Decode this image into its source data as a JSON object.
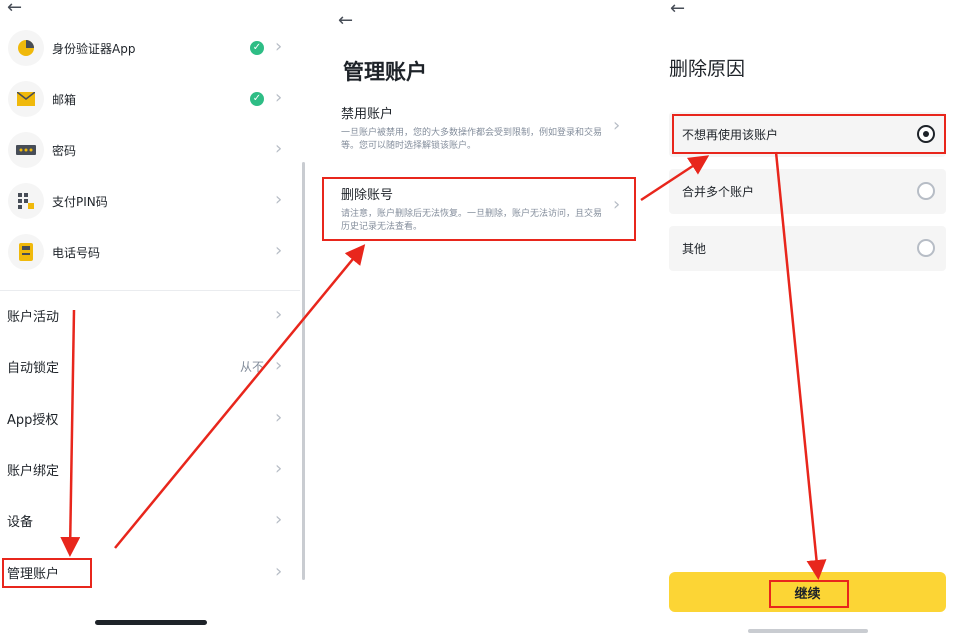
{
  "panel1": {
    "back_icon": "arrow-left-icon",
    "security_items": [
      {
        "label": "身份验证器App",
        "icon": "authenticator-icon",
        "verified": true
      },
      {
        "label": "邮箱",
        "icon": "mail-icon",
        "verified": true
      },
      {
        "label": "密码",
        "icon": "password-icon",
        "verified": false
      },
      {
        "label": "支付PIN码",
        "icon": "pin-icon",
        "verified": false
      },
      {
        "label": "电话号码",
        "icon": "phone-icon",
        "verified": false
      }
    ],
    "menu_items": [
      {
        "label": "账户活动"
      },
      {
        "label": "自动锁定",
        "value": "从不"
      },
      {
        "label": "App授权"
      },
      {
        "label": "账户绑定"
      },
      {
        "label": "设备"
      },
      {
        "label": "管理账户"
      }
    ]
  },
  "panel2": {
    "back_icon": "arrow-left-icon",
    "title": "管理账户",
    "options": [
      {
        "title": "禁用账户",
        "desc": "一旦账户被禁用，您的大多数操作都会受到限制，例如登录和交易等。您可以随时选择解锁该账户。"
      },
      {
        "title": "删除账号",
        "desc": "请注意，账户删除后无法恢复。一旦删除，账户无法访问，且交易历史记录无法查看。"
      }
    ]
  },
  "panel3": {
    "back_icon": "arrow-left-icon",
    "title": "删除原因",
    "reasons": [
      {
        "label": "不想再使用该账户",
        "selected": true
      },
      {
        "label": "合并多个账户",
        "selected": false
      },
      {
        "label": "其他",
        "selected": false
      }
    ],
    "continue_label": "继续"
  },
  "colors": {
    "accent_yellow": "#fcd535",
    "verified_green": "#2ebd85",
    "annotation_red": "#e8261c"
  }
}
